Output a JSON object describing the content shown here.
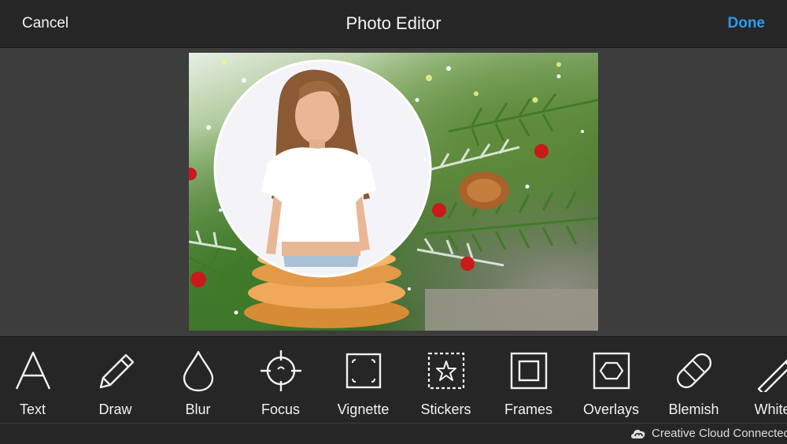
{
  "header": {
    "cancel_label": "Cancel",
    "title": "Photo Editor",
    "done_label": "Done",
    "accent_color": "#2b9cf0"
  },
  "tools": [
    {
      "label": "Text",
      "icon": "text-icon"
    },
    {
      "label": "Draw",
      "icon": "pencil-icon"
    },
    {
      "label": "Blur",
      "icon": "droplet-icon"
    },
    {
      "label": "Focus",
      "icon": "crosshair-icon"
    },
    {
      "label": "Vignette",
      "icon": "vignette-icon"
    },
    {
      "label": "Stickers",
      "icon": "star-sticker-icon"
    },
    {
      "label": "Frames",
      "icon": "frame-icon"
    },
    {
      "label": "Overlays",
      "icon": "hexagon-icon"
    },
    {
      "label": "Blemish",
      "icon": "bandage-icon"
    },
    {
      "label": "Whiten",
      "icon": "wand-icon"
    }
  ],
  "status": {
    "text": "Creative Cloud Connected",
    "icon": "creative-cloud-icon"
  }
}
